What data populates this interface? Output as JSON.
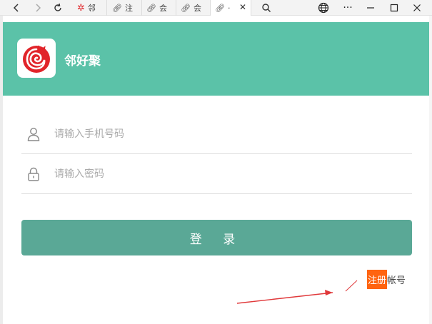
{
  "browser": {
    "tabs": [
      {
        "title": "邻",
        "icon": "app-logo-icon"
      },
      {
        "title": "注",
        "icon": "link-icon"
      },
      {
        "title": "会",
        "icon": "link-icon"
      },
      {
        "title": "会",
        "icon": "link-icon"
      },
      {
        "title": "·",
        "icon": "link-icon",
        "active": true
      }
    ]
  },
  "app": {
    "name": "邻好聚",
    "accent": "#5bc2a8"
  },
  "form": {
    "phone_placeholder": "请输入手机号码",
    "password_placeholder": "请输入密码",
    "login_label": "登 录",
    "register_link": "注册",
    "register_suffix": "帐号"
  }
}
